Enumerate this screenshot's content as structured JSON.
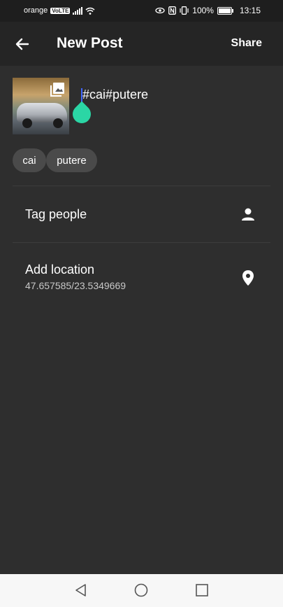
{
  "status_bar": {
    "carrier": "orange",
    "network_badge": "VoLTE",
    "battery": "100%",
    "time": "13:15",
    "icons": [
      "signal-icon",
      "wifi-icon",
      "eye-icon",
      "nfc-icon",
      "vibrate-icon",
      "battery-icon"
    ]
  },
  "app_bar": {
    "title": "New Post",
    "back_icon": "arrow-back-icon",
    "share_label": "Share"
  },
  "post": {
    "image_icon": "gallery-icon",
    "caption": "#cai#putere",
    "tags": [
      "cai",
      "putere"
    ]
  },
  "rows": {
    "tag_people": {
      "label": "Tag people",
      "icon": "person-icon"
    },
    "add_location": {
      "label": "Add location",
      "value": "47.657585/23.5349669",
      "icon": "location-pin-icon"
    }
  },
  "nav_bar": {
    "buttons": [
      "back-triangle-icon",
      "home-circle-icon",
      "recents-square-icon"
    ]
  },
  "colors": {
    "background": "#2e2e2e",
    "app_bar": "#252525",
    "chip": "#4a4a4a",
    "handle": "#2bd6a5",
    "cursor": "#3f66ff"
  }
}
